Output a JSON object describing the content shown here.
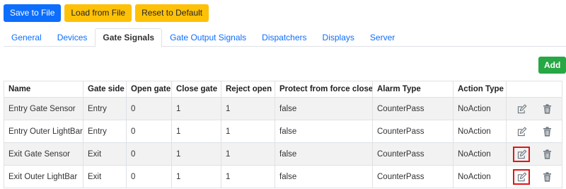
{
  "toolbar": {
    "save_label": "Save to File",
    "load_label": "Load from File",
    "reset_label": "Reset to Default"
  },
  "tabs": [
    {
      "label": "General",
      "active": false
    },
    {
      "label": "Devices",
      "active": false
    },
    {
      "label": "Gate Signals",
      "active": true
    },
    {
      "label": "Gate Output Signals",
      "active": false
    },
    {
      "label": "Dispatchers",
      "active": false
    },
    {
      "label": "Displays",
      "active": false
    },
    {
      "label": "Server",
      "active": false
    }
  ],
  "add_label": "Add",
  "table": {
    "headers": [
      "Name",
      "Gate side",
      "Open gate",
      "Close gate",
      "Reject open",
      "Protect from force close",
      "Alarm Type",
      "Action Type",
      ""
    ],
    "rows": [
      {
        "cells": [
          "Entry Gate Sensor",
          "Entry",
          "0",
          "1",
          "1",
          "false",
          "CounterPass",
          "NoAction"
        ],
        "edit_highlighted": false
      },
      {
        "cells": [
          "Entry Outer LightBar",
          "Entry",
          "0",
          "1",
          "1",
          "false",
          "CounterPass",
          "NoAction"
        ],
        "edit_highlighted": false
      },
      {
        "cells": [
          "Exit Gate Sensor",
          "Exit",
          "0",
          "1",
          "1",
          "false",
          "CounterPass",
          "NoAction"
        ],
        "edit_highlighted": true
      },
      {
        "cells": [
          "Exit Outer LightBar",
          "Exit",
          "0",
          "1",
          "1",
          "false",
          "CounterPass",
          "NoAction"
        ],
        "edit_highlighted": true
      }
    ]
  },
  "icons": {
    "edit": "edit-icon",
    "delete": "trash-icon"
  },
  "colors": {
    "primary": "#0d6efd",
    "warning": "#ffc107",
    "success": "#28a745",
    "highlight": "#e01616",
    "stripe": "#f2f2f2"
  }
}
